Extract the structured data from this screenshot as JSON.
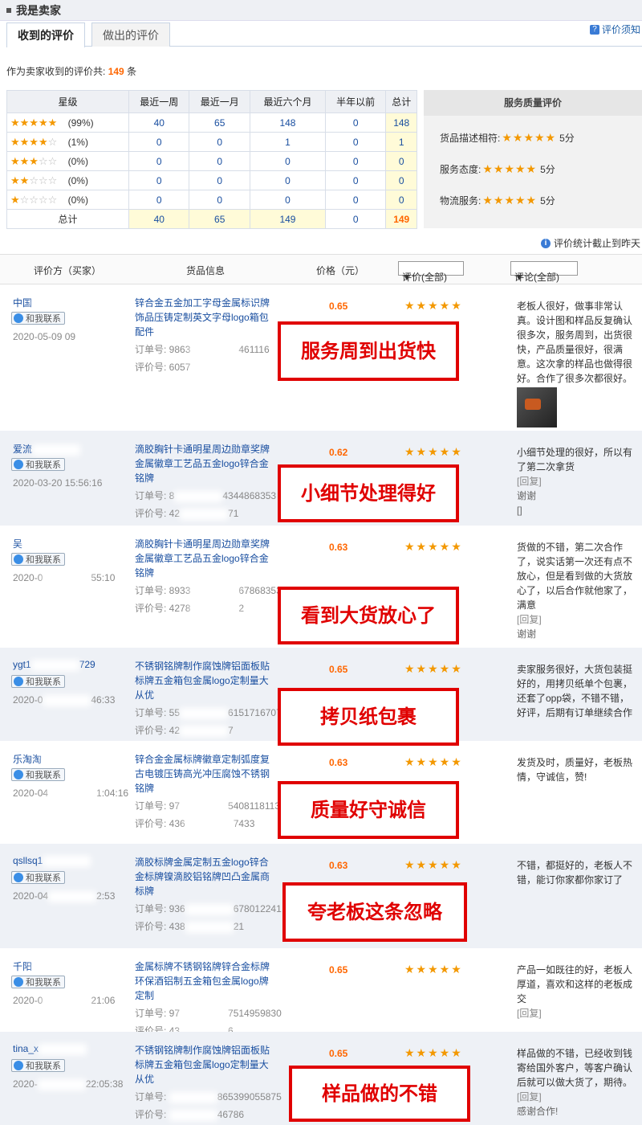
{
  "header": {
    "title": "我是卖家"
  },
  "tabs": [
    {
      "label": "收到的评价"
    },
    {
      "label": "做出的评价"
    }
  ],
  "notice": "评价须知",
  "summary": {
    "prefix": "作为卖家收到的评价共:",
    "count": "149",
    "suffix": "条"
  },
  "stats": {
    "headers": [
      "星级",
      "最近一周",
      "最近一月",
      "最近六个月",
      "半年以前",
      "总计"
    ],
    "rows": [
      {
        "stars": 5,
        "pct": "(99%)",
        "week": "40",
        "month": "65",
        "six": "148",
        "before": "0",
        "total": "148"
      },
      {
        "stars": 4,
        "pct": "(1%)",
        "week": "0",
        "month": "0",
        "six": "1",
        "before": "0",
        "total": "1"
      },
      {
        "stars": 3,
        "pct": "(0%)",
        "week": "0",
        "month": "0",
        "six": "0",
        "before": "0",
        "total": "0"
      },
      {
        "stars": 2,
        "pct": "(0%)",
        "week": "0",
        "month": "0",
        "six": "0",
        "before": "0",
        "total": "0"
      },
      {
        "stars": 1,
        "pct": "(0%)",
        "week": "0",
        "month": "0",
        "six": "0",
        "before": "0",
        "total": "0"
      }
    ],
    "total_row": {
      "label": "总计",
      "week": "40",
      "month": "65",
      "six": "149",
      "before": "0",
      "total": "149"
    }
  },
  "service": {
    "title": "服务质量评价",
    "items": [
      {
        "label": "货品描述相符:",
        "score": "5分"
      },
      {
        "label": "服务态度:",
        "score": "5分"
      },
      {
        "label": "物流服务:",
        "score": "5分"
      }
    ]
  },
  "stats_note": "评价统计截止到昨天",
  "columns": {
    "rater": "评价方（买家）",
    "goods": "货品信息",
    "price": "价格（元）",
    "rating_filter": "评价(全部)",
    "comment_filter": "评论(全部)"
  },
  "labels": {
    "chat": "和我联系",
    "order": "订单号:",
    "review_no": "评价号:"
  },
  "colors": {
    "accent": "#f60",
    "star": "#f39800",
    "banner": "#e00000",
    "link": "#1a4fa0"
  },
  "reviews": [
    {
      "user": "中国",
      "date": "2020-05-09 09",
      "product": "锌合金五金加工字母金属标识牌饰品压铸定制英文字母logo箱包配件",
      "order_a": "9863",
      "order_b": "461116",
      "review_a": "6057",
      "review_b": "",
      "price": "0.65",
      "comment": "老板人很好，做事非常认真。设计图和样品反复确认很多次，服务周到，出货很快，产品质量很好，很满意。这次拿的样品也做得很好。合作了很多次都很好。",
      "reply": "",
      "thanks": "",
      "banner": "服务周到出货快"
    },
    {
      "user": "爱流",
      "date": "2020-03-20 15:56:16",
      "product": "滴胶胸针卡通明星周边勋章奖牌金属徽章工艺品五金logo锌合金铭牌",
      "order_a": "8",
      "order_b": "4344868353",
      "review_a": "42",
      "review_b": "71",
      "price": "0.62",
      "comment": "小细节处理的很好，所以有了第二次拿货",
      "reply": "[回复]",
      "thanks": "谢谢",
      "extra": "[]",
      "banner": "小细节处理得好"
    },
    {
      "user": "吴",
      "date": "2020-0",
      "date_b": "55:10",
      "product": "滴胶胸针卡通明星周边勋章奖牌金属徽章工艺品五金logo锌合金铭牌",
      "order_a": "8933",
      "order_b": "67868353",
      "review_a": "4278",
      "review_b": "2",
      "price": "0.63",
      "comment": "货做的不错，第二次合作了，说实话第一次还有点不放心，但是看到做的大货放心了，以后合作就他家了，满意",
      "reply": "[回复]",
      "thanks": "谢谢",
      "banner": "看到大货放心了"
    },
    {
      "user": "ygt1",
      "user_b": "729",
      "date": "2020-0",
      "date_b": "46:33",
      "product": "不锈钢铭牌制作腐蚀牌铝面板贴标牌五金箱包金属logo定制量大从优",
      "order_a": "55",
      "order_b": "6151716707",
      "review_a": "42",
      "review_b": "7",
      "price": "0.65",
      "comment": "卖家服务很好，大货包装挺好的，用拷贝纸单个包裹，还套了opp袋，不错不错，好评，后期有订单继续合作",
      "reply": "",
      "thanks": "",
      "banner": "拷贝纸包裹"
    },
    {
      "user": "乐淘淘",
      "date": "2020-04",
      "date_b": "1:04:16",
      "product": "锌合金金属标牌徽章定制弧度复古电镀压铸高光冲压腐蚀不锈钢铭牌",
      "order_a": "97",
      "order_b": "54081181134",
      "review_a": "436",
      "review_b": "7433",
      "price": "0.63",
      "comment": "发货及时，质量好，老板热情，守诚信，赞!",
      "reply": "",
      "thanks": "",
      "banner": "质量好守诚信"
    },
    {
      "user": "qsllsq1",
      "date": "2020-04",
      "date_b": "2:53",
      "product": "滴胶标牌金属定制五金logo锌合金标牌镍滴胶铝铭牌凹凸金属商标牌",
      "order_a": "936",
      "order_b": "678012241",
      "review_a": "438",
      "review_b": "21",
      "price": "0.63",
      "comment": "不错，都挺好的，老板人不错，能订你家都你家订了",
      "reply": "",
      "thanks": "",
      "banner": "夸老板这条忽略"
    },
    {
      "user": "千阳",
      "date": "2020-0",
      "date_b": "21:06",
      "product": "金属标牌不锈钢铭牌锌合金标牌环保酒铝制五金箱包金属logo牌定制",
      "order_a": "97",
      "order_b": "7514959830",
      "review_a": "43",
      "review_b": "6",
      "price": "0.65",
      "comment": "产品一如既往的好，老板人厚道，喜欢和这样的老板成交",
      "reply": "[回复]",
      "thanks": "",
      "banner": ""
    },
    {
      "user": "tina_x",
      "date": "2020-",
      "date_b": "22:05:38",
      "product": "不锈钢铭牌制作腐蚀牌铝面板贴标牌五金箱包金属logo定制量大从优",
      "order_a": "",
      "order_b": "865399055875",
      "review_a": "",
      "review_b": "46786",
      "price": "0.65",
      "comment": "样品做的不错，已经收到钱寄给国外客户，等客户确认后就可以做大货了，期待。",
      "reply": "[回复]",
      "thanks": "感谢合作!",
      "banner": "样品做的不错"
    }
  ]
}
